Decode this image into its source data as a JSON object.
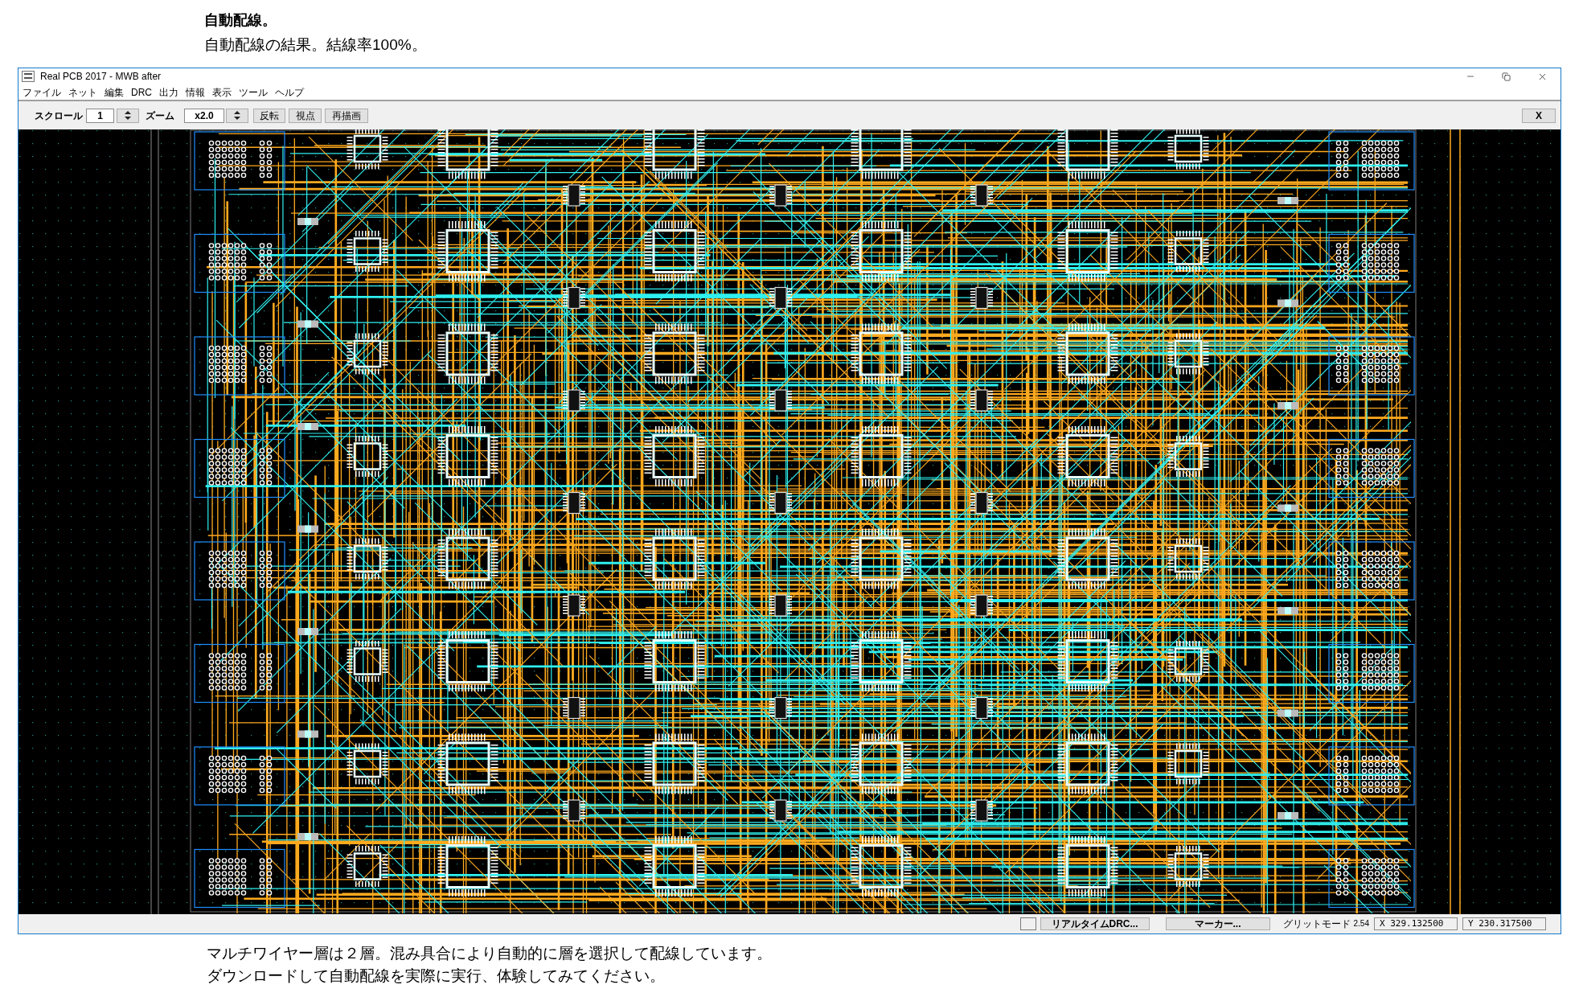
{
  "article": {
    "heading": "自動配線。",
    "subtitle": "自動配線の結果。結線率100%。"
  },
  "window": {
    "title": "Real PCB 2017 - MWB after"
  },
  "menu": [
    "ファイル",
    "ネット",
    "編集",
    "DRC",
    "出力",
    "情報",
    "表示",
    "ツール",
    "ヘルプ"
  ],
  "toolbar": {
    "scroll_label": "スクロール",
    "scroll_value": "1",
    "zoom_label": "ズーム",
    "zoom_value": "x2.0",
    "buttons": [
      "反転",
      "視点",
      "再描画"
    ],
    "close_button": "X"
  },
  "status_bar": {
    "realtime_drc": {
      "label": "リアルタイムDRC...",
      "checked": false
    },
    "marker_button": "マーカー...",
    "grid_mode_label": "グリットモード",
    "grid_value": "2.54",
    "x_readout": "X 329.132500",
    "y_readout": "Y 230.317500"
  },
  "caption": [
    "マルチワイヤー層は２層。混み具合により自動的に層を選択して配線しています。",
    "ダウンロードして自動配線を実際に実行、体験してみてください。"
  ]
}
